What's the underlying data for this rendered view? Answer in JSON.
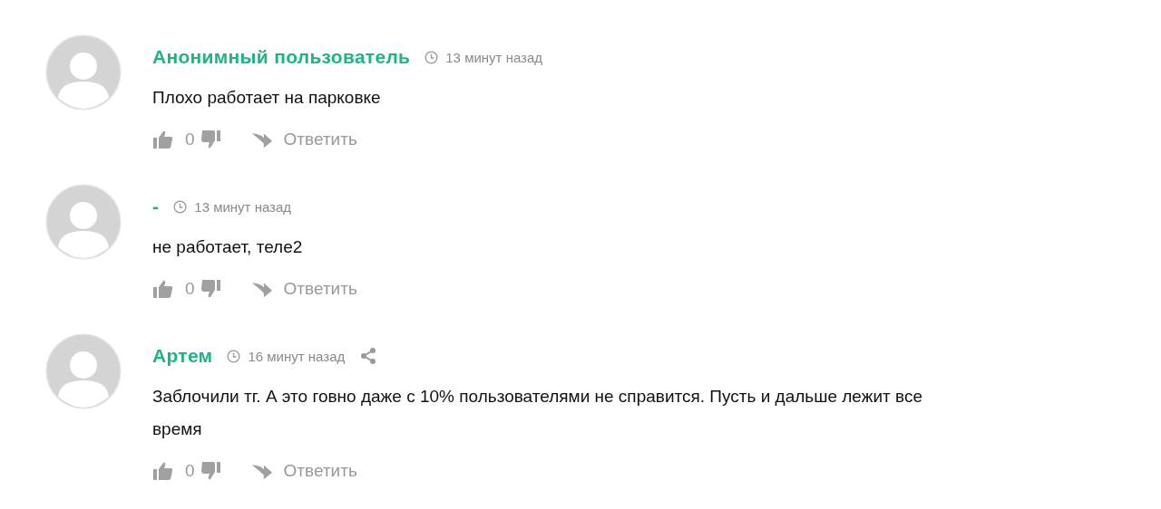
{
  "comments": [
    {
      "author": "Анонимный пользователь",
      "time": "13 минут назад",
      "share": false,
      "text": "Плохо работает на парковке",
      "likes": "0",
      "reply": "Ответить"
    },
    {
      "author": "-",
      "time": "13 минут назад",
      "share": false,
      "text": "не работает, теле2",
      "likes": "0",
      "reply": "Ответить"
    },
    {
      "author": "Артем",
      "time": "16 минут назад",
      "share": true,
      "text": "Заблочили тг. А это говно даже с 10% пользователями не справится. Пусть и дальше лежит все время",
      "likes": "0",
      "reply": "Ответить"
    }
  ]
}
